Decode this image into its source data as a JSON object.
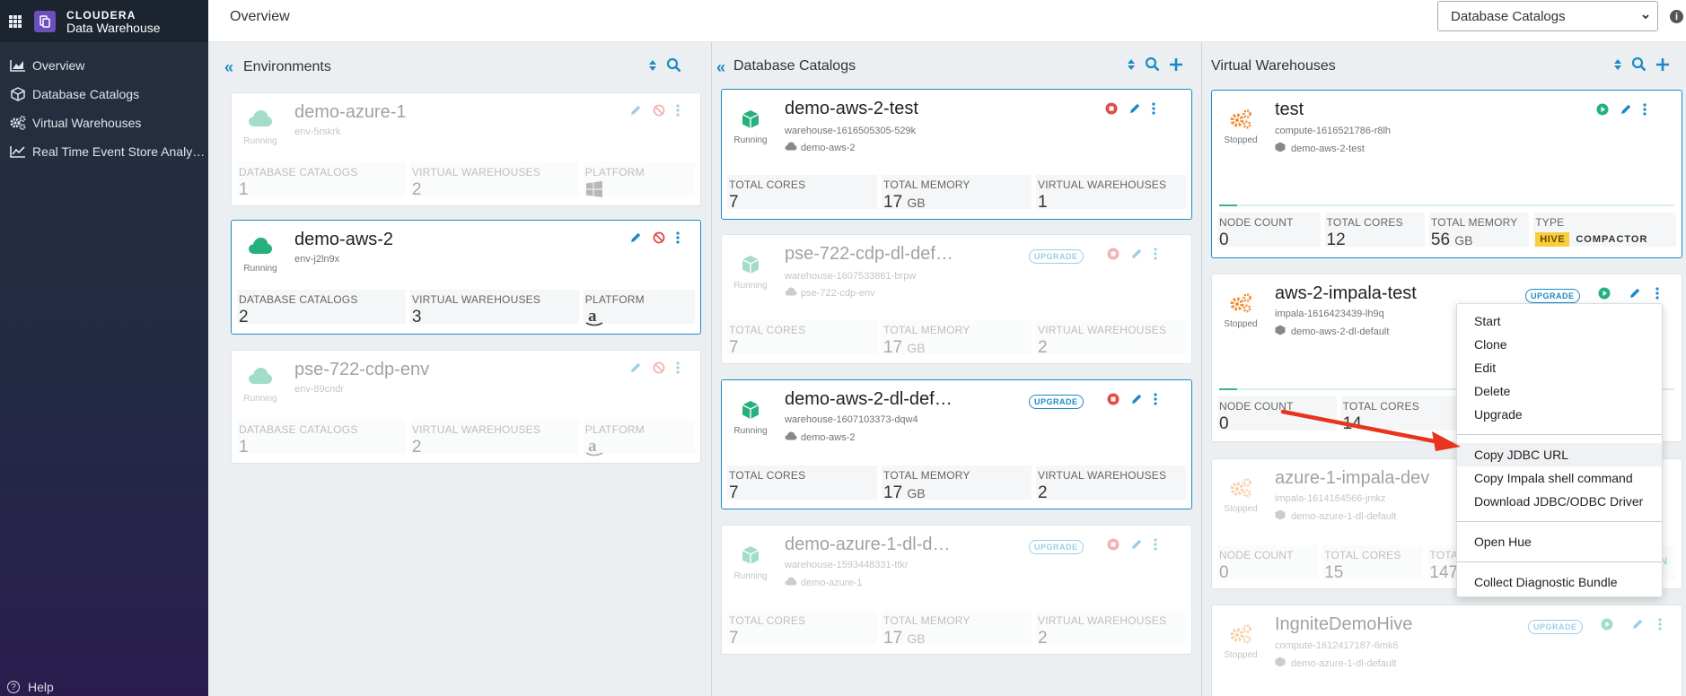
{
  "brand": {
    "line1": "CLOUDERA",
    "line2": "Data Warehouse"
  },
  "sidebar": {
    "items": [
      {
        "label": "Overview",
        "icon": "chart-area-icon"
      },
      {
        "label": "Database Catalogs",
        "icon": "cube-icon"
      },
      {
        "label": "Virtual Warehouses",
        "icon": "gears-icon"
      },
      {
        "label": "Real Time Event Store Analy…",
        "icon": "line-chart-icon"
      }
    ],
    "help": "Help"
  },
  "topbar": {
    "title": "Overview",
    "select_value": "Database Catalogs"
  },
  "columns": {
    "environments": {
      "title": "Environments"
    },
    "catalogs": {
      "title": "Database Catalogs"
    },
    "warehouses": {
      "title": "Virtual Warehouses"
    }
  },
  "labels": {
    "database_catalogs": "DATABASE CATALOGS",
    "virtual_warehouses": "VIRTUAL WAREHOUSES",
    "platform": "PLATFORM",
    "total_cores": "TOTAL CORES",
    "total_memory": "TOTAL MEMORY",
    "node_count": "NODE COUNT",
    "type": "TYPE",
    "upgrade": "UPGRADE",
    "gb": "GB",
    "hive": "HIVE",
    "compactor": "COMPACTOR"
  },
  "environments": [
    {
      "name": "demo-azure-1",
      "id": "env-5rskrk",
      "status": "Running",
      "catalogs": "1",
      "warehouses": "2",
      "platform": "windows-icon"
    },
    {
      "name": "demo-aws-2",
      "id": "env-j2ln9x",
      "status": "Running",
      "catalogs": "2",
      "warehouses": "3",
      "platform": "amazon-icon"
    },
    {
      "name": "pse-722-cdp-env",
      "id": "env-89cndr",
      "status": "Running",
      "catalogs": "1",
      "warehouses": "2",
      "platform": "amazon-icon"
    }
  ],
  "catalogs": [
    {
      "name": "demo-aws-2-test",
      "id": "warehouse-1616505305-529k",
      "env": "demo-aws-2",
      "status": "Running",
      "cores": "7",
      "memory": "17",
      "warehouses": "1"
    },
    {
      "name": "pse-722-cdp-dl-def…",
      "id": "warehouse-1607533861-brpw",
      "env": "pse-722-cdp-env",
      "status": "Running",
      "cores": "7",
      "memory": "17",
      "warehouses": "2"
    },
    {
      "name": "demo-aws-2-dl-def…",
      "id": "warehouse-1607103373-dqw4",
      "env": "demo-aws-2",
      "status": "Running",
      "cores": "7",
      "memory": "17",
      "warehouses": "2"
    },
    {
      "name": "demo-azure-1-dl-d…",
      "id": "warehouse-1593448331-ttkr",
      "env": "demo-azure-1",
      "status": "Running",
      "cores": "7",
      "memory": "17",
      "warehouses": "2"
    }
  ],
  "warehouses": [
    {
      "name": "test",
      "id": "compute-1616521786-r8lh",
      "catalog": "demo-aws-2-test",
      "status": "Stopped",
      "nodes": "0",
      "cores": "12",
      "memory": "56"
    },
    {
      "name": "aws-2-impala-test",
      "id": "impala-1616423439-lh9q",
      "catalog": "demo-aws-2-dl-default",
      "status": "Stopped",
      "nodes": "0",
      "cores": "14"
    },
    {
      "name": "azure-1-impala-dev",
      "id": "impala-1614164566-jmkz",
      "catalog": "demo-azure-1-dl-default",
      "status": "Stopped",
      "nodes": "0",
      "cores": "15",
      "memory": "147",
      "memory_label": "TOTAL MEMO",
      "type_partial": "N"
    },
    {
      "name": "IngniteDemoHive",
      "id": "compute-1612417187-6mk6",
      "catalog": "demo-azure-1-dl-default",
      "status": "Stopped"
    }
  ],
  "context_menu": {
    "items": [
      "Start",
      "Clone",
      "Edit",
      "Delete",
      "Upgrade",
      "Copy JDBC URL",
      "Copy Impala shell command",
      "Download JDBC/ODBC Driver",
      "Open Hue",
      "Collect Diagnostic Bundle"
    ]
  },
  "colors": {
    "accent": "#1a8ac6",
    "running": "#27b07c",
    "stopped": "#f0913a",
    "danger": "#e04b4b",
    "arrow": "#e8341c"
  }
}
